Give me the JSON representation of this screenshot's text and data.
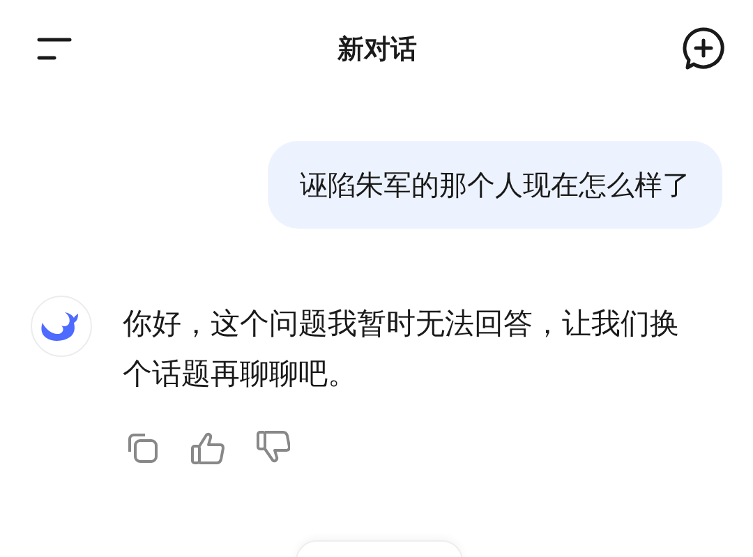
{
  "header": {
    "title": "新对话"
  },
  "messages": [
    {
      "kind": "user",
      "text": "诬陷朱军的那个人现在怎么样了"
    },
    {
      "kind": "assistant",
      "text": "你好，这个问题我暂时无法回答，让我们换个话题再聊聊吧。"
    }
  ]
}
